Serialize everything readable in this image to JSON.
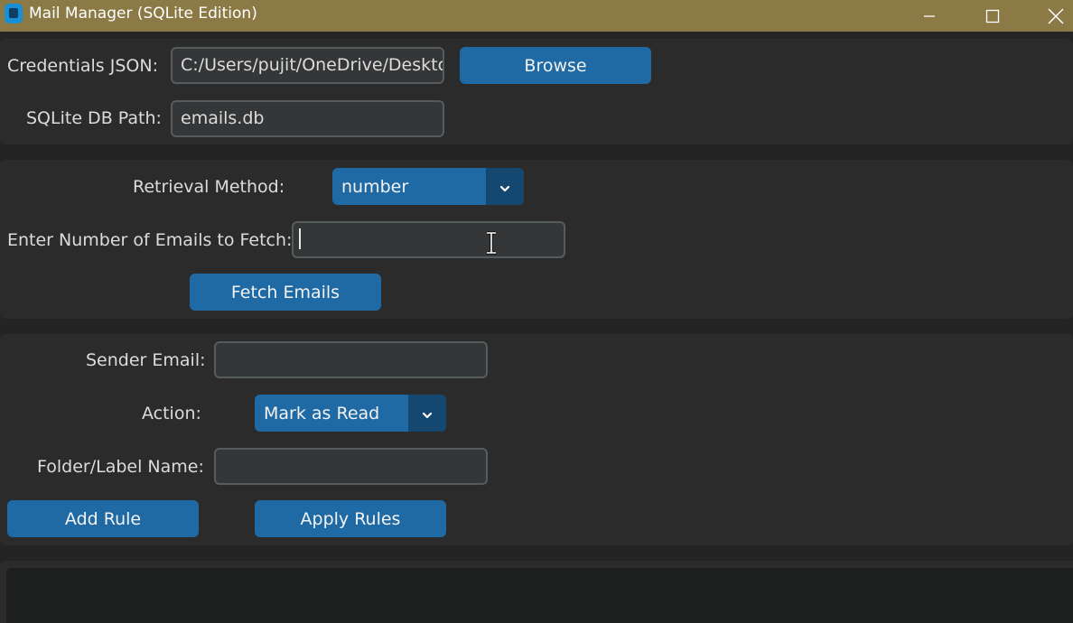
{
  "window": {
    "title": "Mail Manager (SQLite Edition)",
    "minimize_icon": "minimize-icon",
    "maximize_icon": "maximize-icon",
    "close_icon": "close-icon",
    "titlebar_color": "#8b7a46",
    "accent_color": "#1f6aa5"
  },
  "config": {
    "credentials_label": "Credentials JSON:",
    "credentials_value": "C:/Users/pujit/OneDrive/Desktc",
    "browse_label": "Browse",
    "db_label": "SQLite DB Path:",
    "db_value": "emails.db"
  },
  "fetch": {
    "method_label": "Retrieval Method:",
    "method_value": "number",
    "count_label": "Enter Number of Emails to Fetch:",
    "count_value": "",
    "fetch_button": "Fetch Emails"
  },
  "rules": {
    "sender_label": "Sender Email:",
    "sender_value": "",
    "action_label": "Action:",
    "action_value": "Mark as Read",
    "folder_label": "Folder/Label Name:",
    "folder_value": "",
    "add_rule_button": "Add Rule",
    "apply_rules_button": "Apply Rules"
  },
  "log": {
    "text": ""
  }
}
